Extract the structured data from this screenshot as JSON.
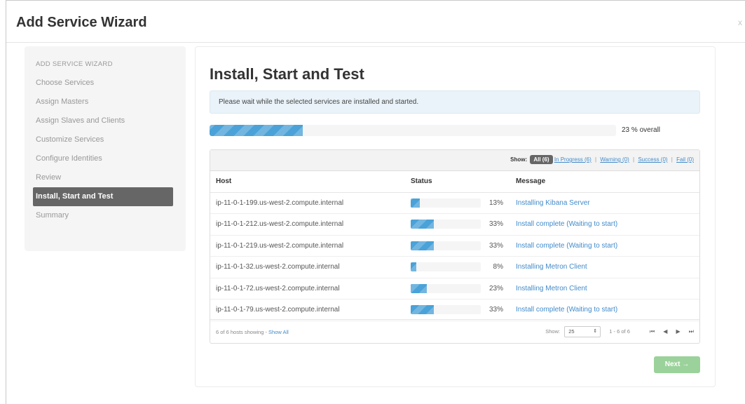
{
  "modal": {
    "title": "Add Service Wizard",
    "close_label": "x"
  },
  "sidebar": {
    "header": "ADD SERVICE WIZARD",
    "items": [
      {
        "label": "Choose Services"
      },
      {
        "label": "Assign Masters"
      },
      {
        "label": "Assign Slaves and Clients"
      },
      {
        "label": "Customize Services"
      },
      {
        "label": "Configure Identities"
      },
      {
        "label": "Review"
      },
      {
        "label": "Install, Start and Test"
      },
      {
        "label": "Summary"
      }
    ],
    "active_index": 6
  },
  "main": {
    "title": "Install, Start and Test",
    "alert": "Please wait while the selected services are installed and started.",
    "overall_progress": 23,
    "overall_text": "23 % overall"
  },
  "filter": {
    "show_label": "Show:",
    "all": "All (6)",
    "in_progress": "In Progress (6)",
    "warning": "Warning (0)",
    "success": "Success (0)",
    "fail": "Fail (0)",
    "separator": "|"
  },
  "table": {
    "headers": {
      "host": "Host",
      "status": "Status",
      "message": "Message"
    },
    "rows": [
      {
        "host": "ip-11-0-1-199.us-west-2.compute.internal",
        "progress": 13,
        "pct": "13%",
        "message": "Installing Kibana Server"
      },
      {
        "host": "ip-11-0-1-212.us-west-2.compute.internal",
        "progress": 33,
        "pct": "33%",
        "message": "Install complete (Waiting to start)"
      },
      {
        "host": "ip-11-0-1-219.us-west-2.compute.internal",
        "progress": 33,
        "pct": "33%",
        "message": "Install complete (Waiting to start)"
      },
      {
        "host": "ip-11-0-1-32.us-west-2.compute.internal",
        "progress": 8,
        "pct": "8%",
        "message": "Installing Metron Client"
      },
      {
        "host": "ip-11-0-1-72.us-west-2.compute.internal",
        "progress": 23,
        "pct": "23%",
        "message": "Installing Metron Client"
      },
      {
        "host": "ip-11-0-1-79.us-west-2.compute.internal",
        "progress": 33,
        "pct": "33%",
        "message": "Install complete (Waiting to start)"
      }
    ]
  },
  "footer": {
    "hosts_showing": "6 of 6 hosts showing - ",
    "show_all": "Show All",
    "show_label": "Show:",
    "page_size": "25",
    "range": "1 - 6 of 6",
    "first": "⏮",
    "prev": "◀",
    "next": "▶",
    "last": "⏭"
  },
  "buttons": {
    "next": "Next →"
  },
  "colors": {
    "progress": "#4aa2d8",
    "accent_link": "#428bca",
    "next_button": "#9bd29b",
    "active_nav": "#666666"
  }
}
